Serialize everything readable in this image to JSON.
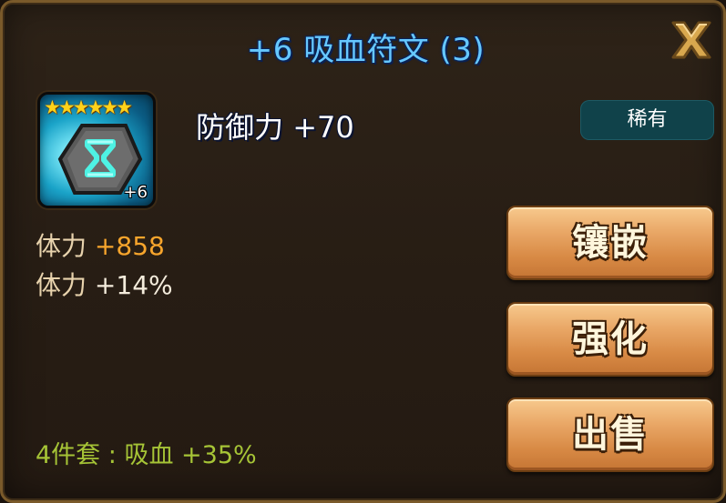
{
  "dialog": {
    "title": "+6 吸血符文 (3)",
    "close_icon": "close-x-icon"
  },
  "rune": {
    "stars": "★★★★★★",
    "star_count": 6,
    "level_label": "+6",
    "slot": 3,
    "icon": "hourglass-rune-icon"
  },
  "main_stat": {
    "label": "防御力",
    "value": "+70"
  },
  "rarity": "稀有",
  "sub_stats": [
    {
      "label": "体力",
      "value": "+858"
    },
    {
      "label": "体力",
      "value": "+14%"
    }
  ],
  "set_effect": {
    "text": "4件套 : 吸血 +35%"
  },
  "actions": {
    "equip_label": "镶嵌",
    "powerup_label": "强化",
    "sell_label": "出售"
  },
  "colors": {
    "title": "#66c8ff",
    "sub_value_flat": "#f7a52c",
    "set_effect": "#a6c436",
    "button": "#e9a766",
    "rarity_badge": "#10424a"
  }
}
